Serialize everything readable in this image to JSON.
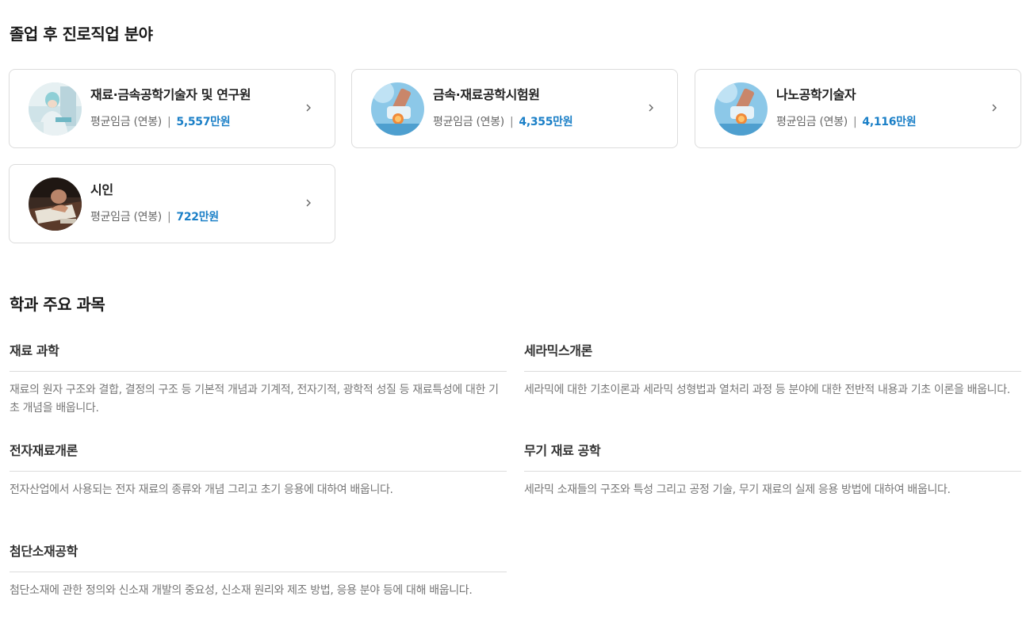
{
  "careers": {
    "title": "졸업 후 진로직업 분야",
    "salary_label": "평균임금 (연봉)",
    "separator": "|",
    "items": [
      {
        "name": "재료·금속공학기술자 및 연구원",
        "salary": "5,557만원",
        "image": "lab-researcher"
      },
      {
        "name": "금속·재료공학시험원",
        "salary": "4,355만원",
        "image": "lab-test-tubes"
      },
      {
        "name": "나노공학기술자",
        "salary": "4,116만원",
        "image": "lab-test-tubes"
      },
      {
        "name": "시인",
        "salary": "722만원",
        "image": "writing-desk"
      }
    ]
  },
  "subjects": {
    "title": "학과 주요 과목",
    "items": [
      {
        "name": "재료 과학",
        "desc": "재료의 원자 구조와 결합, 결정의 구조 등 기본적 개념과 기계적, 전자기적, 광학적 성질 등 재료특성에 대한 기초 개념을 배웁니다."
      },
      {
        "name": "세라믹스개론",
        "desc": "세라믹에 대한 기초이론과 세라믹 성형법과 열처리 과정 등 분야에 대한 전반적 내용과 기초 이론을 배웁니다."
      },
      {
        "name": "전자재료개론",
        "desc": "전자산업에서 사용되는 전자 재료의 종류와 개념 그리고 초기 응용에 대하여 배웁니다."
      },
      {
        "name": "무기 재료 공학",
        "desc": "세라믹 소재들의 구조와 특성 그리고 공정 기술, 무기 재료의 실제 응용 방법에 대하여 배웁니다."
      },
      {
        "name": "첨단소재공학",
        "desc": "첨단소재에 관한 정의와 신소재 개발의 중요성, 신소재 원리와 제조 방법, 응용 분야 등에 대해 배웁니다."
      }
    ]
  },
  "icons": {
    "card_arrow": "chevron-right-icon"
  },
  "colors": {
    "salary_value": "#1a7fc7",
    "border": "#dcdcdc"
  }
}
